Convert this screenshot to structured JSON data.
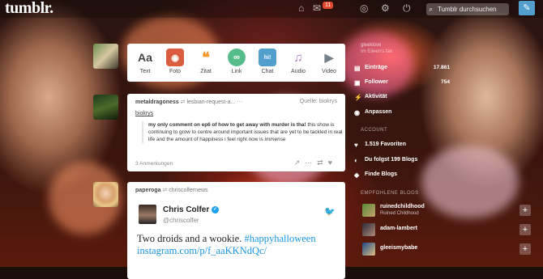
{
  "header": {
    "logo": "tumblr.",
    "notification_count": "11",
    "search_placeholder": "Tumblr durchsuchen"
  },
  "post_types": [
    {
      "label": "Text",
      "icon": "Aa",
      "color": "#444444"
    },
    {
      "label": "Foto",
      "icon": "photo-camera-icon",
      "color": "#d95e40"
    },
    {
      "label": "Zitat",
      "icon": "quote-icon",
      "color": "#f2992e"
    },
    {
      "label": "Link",
      "icon": "link-icon",
      "color": "#56bc8a"
    },
    {
      "label": "Chat",
      "icon": "hi!",
      "color": "#529ecc"
    },
    {
      "label": "Audio",
      "icon": "headphones-icon",
      "color": "#a77dc2"
    },
    {
      "label": "Video",
      "icon": "video-camera-icon",
      "color": "#748089"
    }
  ],
  "post1": {
    "reblogger": "metaldragoness",
    "reblogged_from": "lesbian-request-a...",
    "source_label": "Quelle: biokrys",
    "quoted_user": "biokrys",
    "quote_bold": "my only comment on ep6 of how to get away with murder is tha!",
    "quote_rest": " this show is continuing to grow to centre around important issues that are yet to be tackled in real life and the amount of happiness i feel right now is ",
    "quote_em": "immense",
    "notes": "3 Anmerkungen"
  },
  "post2": {
    "reblogger": "paperoga",
    "reblogged_from": "chriscolfernews",
    "tweet_name": "Chris Colfer",
    "tweet_handle": "@chriscolfer",
    "tweet_text": "Two droids and a wookie. ",
    "tweet_hashtag": "#happyhalloween",
    "tweet_link": "instagram.com/p/f_aaKKNdQc/"
  },
  "sidebar": {
    "blog_title": "gleeklove",
    "blog_subtitle": "Im Eileen's fan",
    "items": [
      {
        "label": "Einträge",
        "count": "17.861",
        "icon": "posts-icon"
      },
      {
        "label": "Follower",
        "count": "754",
        "icon": "followers-icon"
      },
      {
        "label": "Aktivität",
        "count": "",
        "icon": "activity-icon"
      },
      {
        "label": "Anpassen",
        "count": "",
        "icon": "eye-icon"
      }
    ],
    "account_head": "ACCOUNT",
    "account_items": [
      {
        "label": "1.519 Favoriten",
        "icon": "heart-icon"
      },
      {
        "label": "Du folgst 199 Blogs",
        "icon": "following-icon"
      },
      {
        "label": "Finde Blogs",
        "icon": "find-blogs-icon"
      }
    ],
    "recommended_head": "EMPFOHLENE BLOGS",
    "recommended": [
      {
        "name": "ruinedchildhood",
        "sub": "Ruined Childhood"
      },
      {
        "name": "adam-lambert",
        "sub": ""
      },
      {
        "name": "gleeismybabe",
        "sub": ""
      }
    ]
  }
}
